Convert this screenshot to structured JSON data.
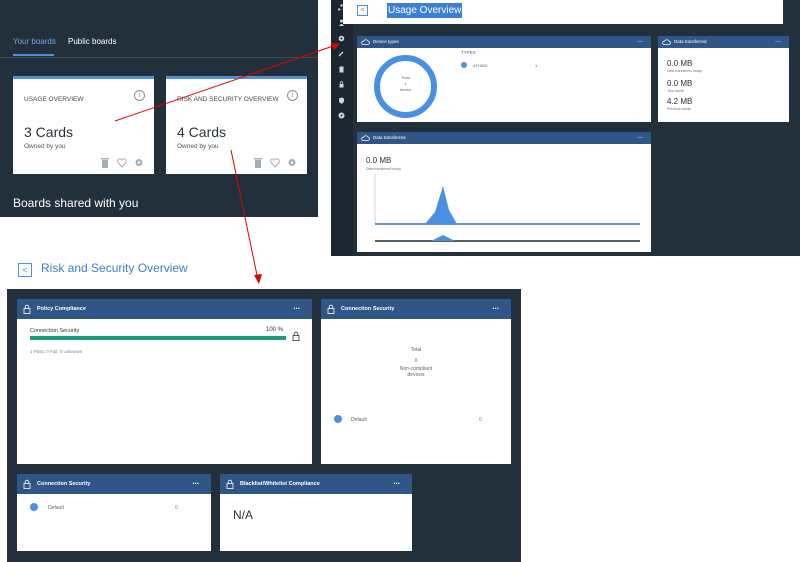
{
  "boards": {
    "tabs": [
      {
        "label": "Your boards"
      },
      {
        "label": "Public boards"
      }
    ],
    "cards": [
      {
        "title": "USAGE OVERVIEW",
        "count": "3 Cards",
        "owner": "Owned by you"
      },
      {
        "title": "RISK AND SECURITY OVERVIEW",
        "count": "4 Cards",
        "owner": "Owned by you"
      }
    ],
    "info_glyph": "i",
    "shared_title": "Boards shared with you"
  },
  "usage": {
    "title": "Usage Overview",
    "back_glyph": "<",
    "device_types": {
      "title": "Device types",
      "menu": "...",
      "donut_lines": [
        "Total",
        "1",
        "device"
      ],
      "types_label": "TYPES",
      "legend_name": "ATH630",
      "legend_value": "1"
    },
    "data_transferred_card": {
      "title": "Data transferred",
      "menu": "...",
      "today_value": "0.0 MB",
      "today_label": "Data transferred today",
      "month_value": "0.0 MB",
      "month_label": "This month",
      "prev_value": "4.2 MB",
      "prev_label": "Previous month"
    },
    "data_chart_card": {
      "title": "Data transferred",
      "menu": "...",
      "big_value": "0.0 MB",
      "big_label": "Data transferred today"
    }
  },
  "risk": {
    "title": "Risk and Security Overview",
    "back_glyph": "<",
    "policy": {
      "title": "Policy Compliance",
      "menu": "...",
      "row_label": "Connection Security",
      "percent": "100 %",
      "fill": 1.0,
      "summary": "1 Pass; 0 Fail; 0 Unknown"
    },
    "conn_security_top": {
      "title": "Connection Security",
      "menu": "...",
      "total_label": "Total",
      "total_value": "0",
      "devices_label_1": "Non-compliant",
      "devices_label_2": "devices",
      "legend_name": "Default",
      "legend_value": "0"
    },
    "conn_security_bottom": {
      "title": "Connection Security",
      "menu": "...",
      "legend_name": "Default",
      "legend_value": "0"
    },
    "blacklist": {
      "title": "Blacklist/Whitelist Compliance",
      "menu": "...",
      "value": "N/A"
    }
  },
  "colors": {
    "accent": "#4e8fe0",
    "dark_bg": "#22303c",
    "card_header": "#2f5687",
    "success": "#1e9b7a",
    "arrow": "#e00000"
  }
}
